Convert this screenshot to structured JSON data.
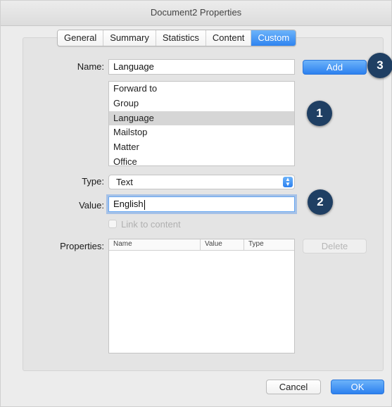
{
  "window": {
    "title": "Document2 Properties"
  },
  "tabs": [
    {
      "label": "General"
    },
    {
      "label": "Summary"
    },
    {
      "label": "Statistics"
    },
    {
      "label": "Content"
    },
    {
      "label": "Custom",
      "active": true
    }
  ],
  "form": {
    "name_label": "Name:",
    "name_value": "Language",
    "add_label": "Add",
    "list_items": [
      "Forward to",
      "Group",
      "Language",
      "Mailstop",
      "Matter",
      "Office"
    ],
    "selected_item": "Language",
    "type_label": "Type:",
    "type_value": "Text",
    "value_label": "Value:",
    "value_value": "English",
    "link_label": "Link to content",
    "properties_label": "Properties:",
    "columns": [
      "Name",
      "Value",
      "Type"
    ],
    "delete_label": "Delete"
  },
  "footer": {
    "cancel_label": "Cancel",
    "ok_label": "OK"
  },
  "callouts": [
    "1",
    "2",
    "3"
  ],
  "colors": {
    "accent": "#2f84f0",
    "badge": "#1f3f63"
  }
}
